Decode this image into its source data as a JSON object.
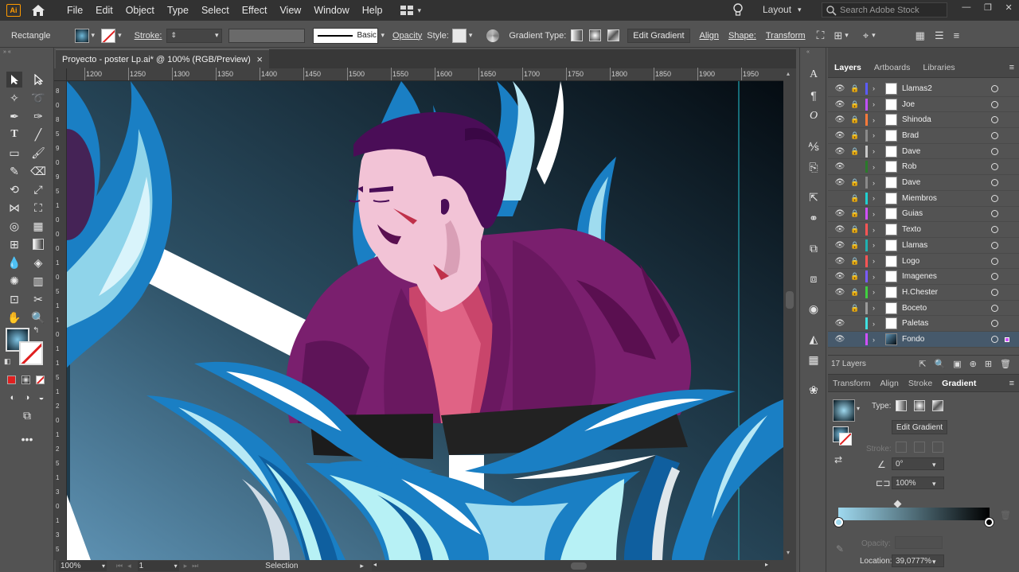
{
  "menubar": {
    "app_icon": "Ai",
    "items": [
      "File",
      "Edit",
      "Object",
      "Type",
      "Select",
      "Effect",
      "View",
      "Window",
      "Help"
    ],
    "workspace": "Layout",
    "search_placeholder": "Search Adobe Stock"
  },
  "controlbar": {
    "tool_name": "Rectangle",
    "stroke_label": "Stroke:",
    "brush_label": "Basic",
    "opacity_label": "Opacity",
    "style_label": "Style:",
    "gradient_type_label": "Gradient Type:",
    "edit_gradient_label": "Edit Gradient",
    "align_label": "Align",
    "shape_label": "Shape:",
    "transform_label": "Transform"
  },
  "document": {
    "tab_title": "Proyecto - poster Lp.ai* @ 100% (RGB/Preview)",
    "close_glyph": "×"
  },
  "ruler": {
    "h_ticks": [
      "1200",
      "1250",
      "1300",
      "1350",
      "1400",
      "1450",
      "1500",
      "1550",
      "1600",
      "1650",
      "1700",
      "1750",
      "1800",
      "1850",
      "1900",
      "1950"
    ],
    "v_ticks": [
      "8",
      "0",
      "8",
      "5",
      "9",
      "0",
      "9",
      "5",
      "1",
      "0",
      "0",
      "0",
      "1",
      "0",
      "5",
      "1",
      "1",
      "0",
      "1",
      "1",
      "5",
      "1",
      "2",
      "0",
      "1",
      "2",
      "5",
      "1",
      "3",
      "0",
      "1",
      "3",
      "5"
    ]
  },
  "statusbar": {
    "zoom": "100%",
    "artboard": "1",
    "tool_status": "Selection"
  },
  "layers_panel": {
    "tabs": [
      "Layers",
      "Artboards",
      "Libraries"
    ],
    "active_tab": "Layers",
    "count_label": "17 Layers",
    "layers": [
      {
        "name": "Llamas2",
        "color": "#5b5bff",
        "visible": true,
        "locked": true
      },
      {
        "name": "Joe",
        "color": "#c050ff",
        "visible": true,
        "locked": true
      },
      {
        "name": "Shinoda",
        "color": "#ff7a3a",
        "visible": true,
        "locked": true
      },
      {
        "name": "Brad",
        "color": "#8a8a8a",
        "visible": true,
        "locked": true
      },
      {
        "name": "Dave",
        "color": "#c8c8c8",
        "visible": true,
        "locked": true
      },
      {
        "name": "Rob",
        "color": "#2a7a2a",
        "visible": true,
        "locked": false
      },
      {
        "name": "Dave",
        "color": "#8a8a8a",
        "visible": true,
        "locked": true
      },
      {
        "name": "Miembros",
        "color": "#20d0d0",
        "visible": false,
        "locked": true
      },
      {
        "name": "Guias",
        "color": "#d050ff",
        "visible": true,
        "locked": true
      },
      {
        "name": "Texto",
        "color": "#ff5555",
        "visible": true,
        "locked": true
      },
      {
        "name": "Llamas",
        "color": "#20b0b0",
        "visible": true,
        "locked": true
      },
      {
        "name": "Logo",
        "color": "#ff5555",
        "visible": true,
        "locked": true
      },
      {
        "name": "Imagenes",
        "color": "#7a5aff",
        "visible": true,
        "locked": true
      },
      {
        "name": "H.Chester",
        "color": "#40d040",
        "visible": true,
        "locked": true
      },
      {
        "name": "Boceto",
        "color": "#9a9a9a",
        "visible": false,
        "locked": true
      },
      {
        "name": "Paletas",
        "color": "#40e0e0",
        "visible": true,
        "locked": false
      },
      {
        "name": "Fondo",
        "color": "#d050ff",
        "visible": true,
        "locked": false,
        "selected": true
      }
    ]
  },
  "gradient_panel": {
    "tabs": [
      "Transform",
      "Align",
      "Stroke",
      "Gradient"
    ],
    "active_tab": "Gradient",
    "type_label": "Type:",
    "edit_gradient_label": "Edit Gradient",
    "stroke_label": "Stroke:",
    "angle_value": "0°",
    "aspect_value": "100%",
    "opacity_label": "Opacity:",
    "location_label": "Location:",
    "location_value": "39,0777%",
    "gradient_start": "#9fd9ef",
    "gradient_end": "#000000"
  },
  "colors": {
    "ui_dark": "#323232",
    "ui_mid": "#535353",
    "selection_blue": "#46596b",
    "flame_blue": "#1a7fc4",
    "flame_light": "#b7f1f5",
    "skin": "#f2c3d6",
    "jacket": "#7a1f6e",
    "hair": "#4a0d57"
  }
}
